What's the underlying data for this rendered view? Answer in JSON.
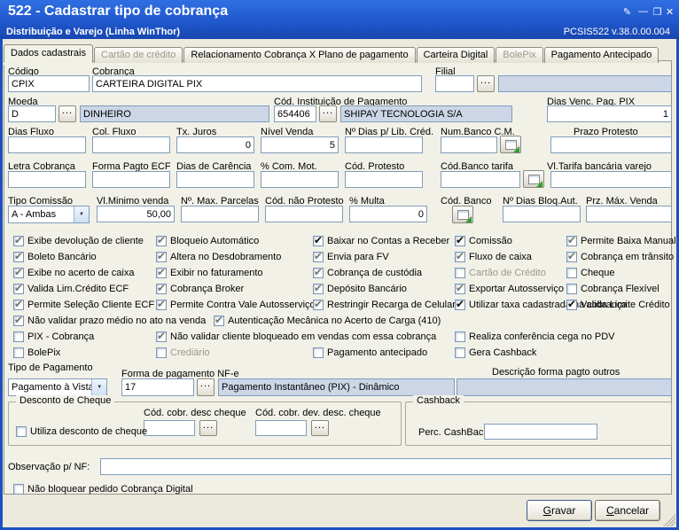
{
  "window": {
    "title": "522 - Cadastrar tipo de cobrança",
    "subtitle": "Distribuição e Varejo (Linha WinThor)",
    "version": "PCSIS522 v.38.0.00.004"
  },
  "icons": {
    "dots": "...",
    "dropdown": "▼",
    "pencil": "✎",
    "minimize": "—",
    "maximize": "❐",
    "close": "✕"
  },
  "tabs": [
    {
      "label": "Dados cadastrais"
    },
    {
      "label": "Cartão de crédito"
    },
    {
      "label": "Relacionamento Cobrança X Plano de pagamento"
    },
    {
      "label": "Carteira Digital"
    },
    {
      "label": "BolePix"
    },
    {
      "label": "Pagamento Antecipado"
    }
  ],
  "f": {
    "codigo": "Código",
    "cobranca": "Cobrança",
    "filial": "Filial",
    "moeda": "Moeda",
    "inst": "Cód. Instituição de Pagamento",
    "dias_venc": "Dias Venc. Pag. PIX",
    "dias_fluxo": "Dias Fluxo",
    "col_fluxo": "Col. Fluxo",
    "tx_juros": "Tx. Juros",
    "nivel_venda": "Nível Venda",
    "dias_lib": "Nº Dias p/ Lib. Créd.",
    "num_banco_cm": "Num.Banco C.M.",
    "prazo_protesto": "Prazo Protesto",
    "letra": "Letra Cobrança",
    "forma_ecf": "Forma Pagto ECF",
    "dias_carencia": "Dias de Carência",
    "com_mot": "% Com. Mot.",
    "cod_protesto": "Cód. Protesto",
    "cod_banco_tarifa": "Cód.Banco tarifa",
    "vl_tarifa": "Vl.Tarifa bancária varejo",
    "tipo_comissao": "Tipo Comissão",
    "vl_minimo": "Vl.Minimo venda",
    "max_parcelas": "Nº. Max. Parcelas",
    "cod_nao_protesto": "Cód. não Protesto",
    "multa": "% Multa",
    "cod_banco": "Cód. Banco",
    "dias_bloq": "Nº Dias Bloq.Aut.",
    "prz_max": "Prz. Máx. Venda",
    "tipo_pagamento": "Tipo de Pagamento",
    "forma_nfe": "Forma de pagamento NF-e",
    "desc_outros": "Descrição forma pagto outros",
    "cod_desc_cheque": "Cód. cobr. desc cheque",
    "cod_dev_cheque": "Cód. cobr. dev. desc. cheque",
    "perc_cashback": "Perc. CashBack",
    "obs": "Observação p/ NF:"
  },
  "v": {
    "codigo": "CPIX",
    "cobranca": "CARTEIRA DIGITAL PIX",
    "moeda": "D",
    "moeda_desc": "DINHEIRO",
    "inst": "654406",
    "inst_desc": "SHIPAY TECNOLOGIA S/A",
    "dias_venc": "1",
    "tx_juros": "0",
    "nivel_venda": "5",
    "tipo_comissao": "A - Ambas",
    "vl_minimo": "50,00",
    "multa": "0",
    "tipo_pagamento": "Pagamento à Vista",
    "forma_nfe": "17",
    "forma_nfe_desc": "Pagamento Instantâneo (PIX) - Dinâmico"
  },
  "groups": {
    "desconto": "Desconto de Cheque",
    "cashback": "Cashback"
  },
  "buttons": {
    "gravar": "Gravar",
    "cancelar": "Cancelar"
  },
  "checks": [
    {
      "label": "Exibe devolução de cliente",
      "checked": true
    },
    {
      "label": "Bloqueio Automático",
      "checked": true
    },
    {
      "label": "Baixar no Contas a Receber",
      "checked": true,
      "strong": true
    },
    {
      "label": "Comissão",
      "checked": true,
      "strong": true
    },
    {
      "label": "Permite Baixa Manual",
      "checked": true
    },
    {
      "label": "Boleto Bancário",
      "checked": true
    },
    {
      "label": "Altera no Desdobramento",
      "checked": true
    },
    {
      "label": "Envia para FV",
      "checked": true
    },
    {
      "label": "Fluxo de caixa",
      "checked": true
    },
    {
      "label": "Cobrança em trânsito",
      "checked": true
    },
    {
      "label": "Exibe no acerto de caixa",
      "checked": true
    },
    {
      "label": "Exibir no faturamento",
      "checked": true
    },
    {
      "label": "Cobrança de custódia",
      "checked": true
    },
    {
      "label": "Cartão de Crédito",
      "checked": false,
      "disabled": true
    },
    {
      "label": "Cheque",
      "checked": false
    },
    {
      "label": "Valida Lim.Crédito ECF",
      "checked": true
    },
    {
      "label": "Cobrança Broker",
      "checked": true
    },
    {
      "label": "Depósito Bancário",
      "checked": true
    },
    {
      "label": "Exportar Autosserviço",
      "checked": true
    },
    {
      "label": "Cobrança Flexível",
      "checked": false
    },
    {
      "label": "Permite Seleção Cliente ECF",
      "checked": true
    },
    {
      "label": "Permite Contra Vale Autosserviço",
      "checked": true
    },
    {
      "label": "Restringir Recarga de Celular",
      "checked": true
    },
    {
      "label": "Utilizar taxa cadastrada na cobrança",
      "checked": true,
      "strong": true
    },
    {
      "label": "Valida Limite Crédito",
      "checked": true,
      "strong": true
    },
    {
      "label": "Não validar prazo médio no ato na venda",
      "checked": true
    },
    {
      "label": "Autenticação Mecânica no Acerto de Carga (410)",
      "checked": true
    },
    {
      "label": "PIX - Cobrança",
      "checked": false
    },
    {
      "label": "Não validar cliente bloqueado em vendas com essa cobrança",
      "checked": true
    },
    {
      "label": "Realiza conferência cega no PDV",
      "checked": false
    },
    {
      "label": "BolePix",
      "checked": false
    },
    {
      "label": "Crediário",
      "checked": false,
      "disabled": true
    },
    {
      "label": "Pagamento antecipado",
      "checked": false
    },
    {
      "label": "Gera Cashback",
      "checked": false
    },
    {
      "label": "Utiliza desconto de cheque",
      "checked": false
    },
    {
      "label": "Não bloquear pedido Cobrança Digital",
      "checked": false
    }
  ]
}
